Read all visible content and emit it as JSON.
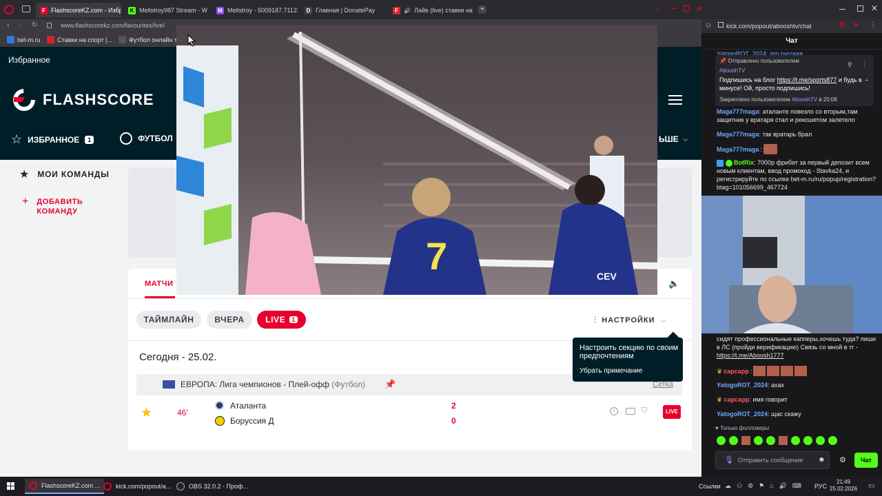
{
  "left_browser": {
    "tabs": [
      {
        "title": "FlashscoreKZ.com - Избр",
        "fav_color": "#e8002d",
        "fav_letter": "F"
      },
      {
        "title": "Mellstroy987 Stream - W",
        "fav_color": "#53fc18",
        "fav_letter": "K"
      },
      {
        "title": "Mellstroy - 5009187.71122",
        "fav_color": "#9147ff",
        "fav_letter": "M"
      },
      {
        "title": "Главная | DonatePay",
        "fav_color": "#444",
        "fav_letter": "D"
      },
      {
        "title": "Лайв (live) ставки на",
        "fav_color": "#d4252b",
        "fav_letter": "F"
      }
    ],
    "url": "www.flashscorekz.com/favourites/live/",
    "bookmarks": [
      {
        "label": "bet-m.ru",
        "fav_color": "#2e7dd7"
      },
      {
        "label": "Ставки на спорт |...",
        "fav_color": "#d4252b"
      },
      {
        "label": "Футбол онлайн т...",
        "fav_color": "#555"
      }
    ]
  },
  "flashscore": {
    "favorites_heading": "Избранное",
    "logo_text": "FLASHSCORE",
    "nav": {
      "favorites_label": "ИЗБРАННОЕ",
      "favorites_count": "1",
      "football_label": "ФУТБОЛ",
      "more_label": "ЬШЕ"
    },
    "sidebar": {
      "my_teams": "МОИ КОМАНДЫ",
      "add_team": "ДОБАВИТЬ КОМАНДУ"
    },
    "matches_tab": "МАТЧИ",
    "filters": {
      "timeline": "ТАЙМЛАЙН",
      "yesterday": "ВЧЕРА",
      "live": "LIVE",
      "live_count": "1",
      "settings": "НАСТРОЙКИ"
    },
    "tooltip": {
      "text": "Настроить секцию по своим предпочтениям",
      "dismiss": "Убрать примечание"
    },
    "date_heading": "Сегодня - 25.02.",
    "league": {
      "name": "ЕВРОПА: Лига чемпионов - Плей-офф",
      "sport": "(Футбол)",
      "bracket": "Сетка"
    },
    "match": {
      "minute": "46'",
      "home": "Аталанта",
      "away": "Боруссия Д",
      "home_score": "2",
      "away_score": "0",
      "live_badge": "LIVE"
    }
  },
  "video": {
    "watermark": "CEV",
    "jersey_number": "7"
  },
  "right_browser": {
    "url": "kick.com/popout/abooshtv/chat",
    "chat_title": "Чат",
    "pinned": {
      "header": "Отправлено пользователем",
      "sender": "AbooshTV",
      "line1": "Подпишись на блог",
      "link": "https://t.me/sports877",
      "line2": "и будь в минусе! Ой, просто подпишись!",
      "pinned_by": "Закреплено пользователем",
      "pinned_user": "AbooshTV",
      "pinned_time": "в 20:08"
    },
    "top_partial": "YatogoROT_2024: это русская",
    "messages_top": [
      {
        "user": "Maga777maga",
        "text": "аталанте повезло со вторым,там защитник у вратаря стал и рекошетом залетело"
      },
      {
        "user": "Maga777maga",
        "text": "так вратарь брал"
      },
      {
        "user": "Maga777maga",
        "text": ""
      },
      {
        "user": "BotRix",
        "text": "7000р фрибет за первый депозит всем новым клиентам, ввод промокод - Stavka24, и регистрируйте по ссылке bet-m.ru/ru/popup/registration?btag=101056699_467724"
      }
    ],
    "messages_bottom": [
      {
        "user": "",
        "text": "сидят профессиональные капперы,хочешь туда? пиши в ЛС (пройди верификацию) Связь со мной в тг - ",
        "link": "https://t.me/Aboosh1777"
      },
      {
        "user": "сарсарр",
        "text": ""
      },
      {
        "user": "YatogoROT_2024",
        "text": "ахах"
      },
      {
        "user": "сарсарр",
        "text": "имя говорит"
      },
      {
        "user": "YatogoROT_2024",
        "text": "щас скажу"
      }
    ],
    "followers_only": "Только фолловеры",
    "input_placeholder": "Отправить сообщение",
    "send_label": "Чат"
  },
  "taskbar": {
    "apps": [
      {
        "label": "FlashscoreKZ.com ..."
      },
      {
        "label": "kick.com/popout/a..."
      },
      {
        "label": "OBS 32.0.2 - Проф..."
      }
    ],
    "links_label": "Ссылки",
    "lang": "РУС",
    "time": "21:49",
    "date": "25.02.2026"
  },
  "colors": {
    "flashscore_red": "#e8002d",
    "flashscore_navy": "#001e28",
    "kick_green": "#53fc18",
    "star_yellow": "#f6c400"
  }
}
